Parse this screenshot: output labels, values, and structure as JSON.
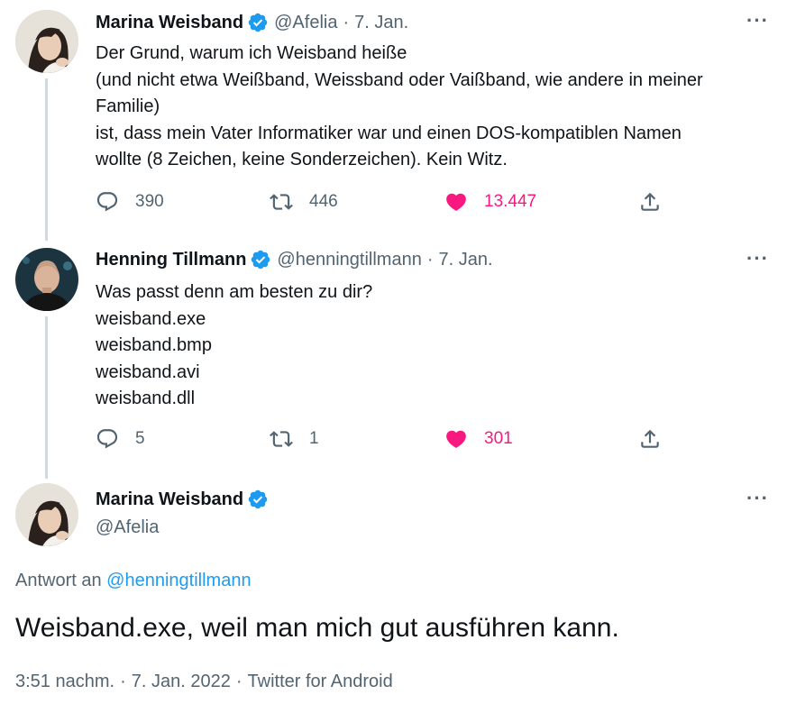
{
  "tweets": [
    {
      "name": "Marina Weisband",
      "handle": "@Afelia",
      "separator": "·",
      "date": "7. Jan.",
      "lines": [
        "Der Grund, warum ich Weisband heiße",
        "(und nicht etwa Weißband, Weissband oder Vaißband, wie andere in meiner",
        "Familie)",
        "ist, dass mein Vater Informatiker war und einen DOS-kompatiblen Namen",
        "wollte (8 Zeichen, keine Sonderzeichen). Kein Witz."
      ],
      "replies": "390",
      "retweets": "446",
      "likes": "13.447"
    },
    {
      "name": "Henning Tillmann",
      "handle": "@henningtillmann",
      "separator": "·",
      "date": "7. Jan.",
      "lines": [
        "Was passt denn am besten zu dir?",
        "weisband.exe",
        "weisband.bmp",
        "weisband.avi",
        "weisband.dll"
      ],
      "replies": "5",
      "retweets": "1",
      "likes": "301"
    }
  ],
  "main_tweet": {
    "name": "Marina Weisband",
    "handle": "@Afelia",
    "reply_prefix": "Antwort an",
    "reply_to": "@henningtillmann",
    "text": "Weisband.exe, weil man mich gut ausführen kann.",
    "time": "3:51 nachm.",
    "date": "7. Jan. 2022",
    "source": "Twitter for Android",
    "separator": "·"
  },
  "more_glyph": "···",
  "colors": {
    "verified": "#1d9bf0",
    "like": "#f91880",
    "secondary": "#536471",
    "thread_line": "#cfd9de",
    "link": "#1d9bf0"
  },
  "icons": {
    "reply": "reply-icon",
    "retweet": "retweet-icon",
    "like": "heart-icon",
    "share": "share-icon",
    "verified": "verified-badge-icon",
    "more": "more-icon"
  }
}
